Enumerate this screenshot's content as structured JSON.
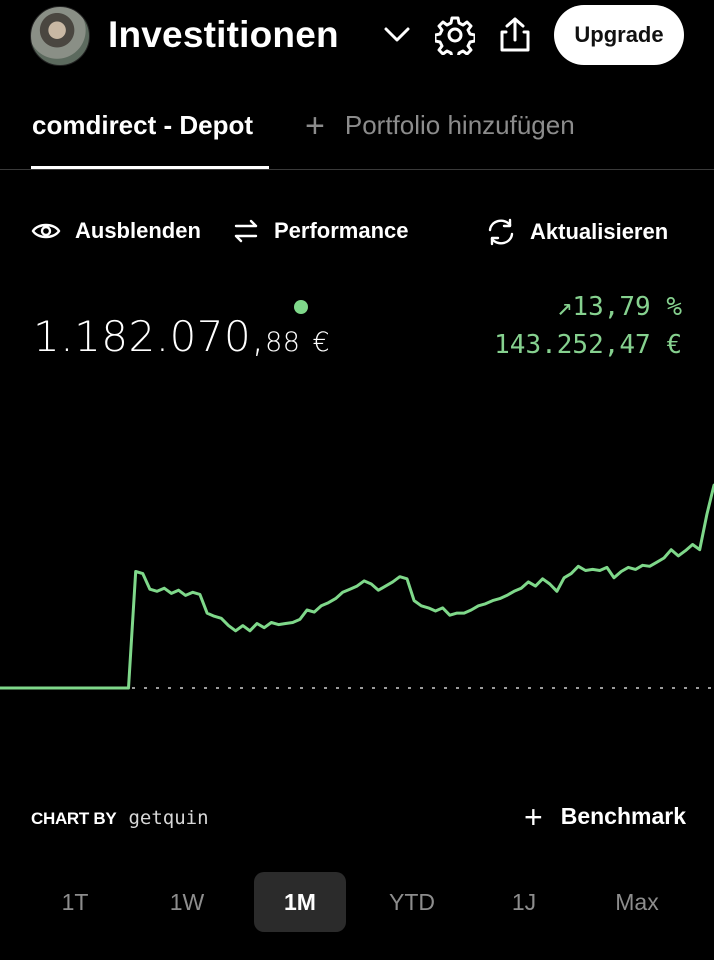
{
  "header": {
    "title": "Investitionen",
    "icons": [
      "avatar",
      "chevron-down-icon",
      "gear-icon",
      "share-icon"
    ],
    "upgrade_label": "Upgrade"
  },
  "tabs": {
    "active_label": "comdirect - Depot",
    "add_label": "Portfolio hinzufügen"
  },
  "actions": {
    "hide_label": "Ausblenden",
    "performance_label": "Performance",
    "refresh_label": "Aktualisieren"
  },
  "portfolio": {
    "value_main": "1.182.070,",
    "value_cents": "88",
    "currency": "€",
    "gain_percent": "↗13,79 %",
    "gain_amount": "143.252,47 €"
  },
  "colors": {
    "accent_green": "#7fd88a",
    "background": "#000000"
  },
  "chart_data": {
    "type": "line",
    "title": "",
    "xlabel": "",
    "ylabel": "",
    "baseline": 0,
    "x": [
      0,
      1,
      2,
      3,
      4,
      5,
      6,
      7,
      8,
      9,
      10,
      11,
      12,
      13,
      14,
      15,
      16,
      17,
      18,
      19,
      20,
      21,
      22,
      23,
      24,
      25,
      26,
      27,
      28,
      29,
      30,
      31,
      32,
      33,
      34,
      35,
      36,
      37,
      38,
      39,
      40,
      41,
      42,
      43,
      44,
      45,
      46,
      47,
      48,
      49,
      50,
      51,
      52,
      53,
      54,
      55,
      56,
      57,
      58,
      59,
      60,
      61,
      62,
      63,
      64,
      65,
      66,
      67,
      68,
      69,
      70,
      71,
      72,
      73,
      74,
      75,
      76,
      77,
      78,
      79,
      80,
      81,
      82,
      83,
      84,
      85,
      86,
      87,
      88,
      89,
      90,
      91,
      92,
      93,
      94,
      95,
      96,
      97,
      98,
      99,
      100
    ],
    "y": [
      0,
      0,
      0,
      0,
      0,
      0,
      0,
      0,
      0,
      0,
      0,
      0,
      0,
      0,
      0,
      0,
      0,
      0,
      0,
      112,
      110,
      95,
      93,
      96,
      91,
      94,
      89,
      92,
      90,
      72,
      69,
      67,
      60,
      55,
      60,
      55,
      62,
      58,
      63,
      61,
      62,
      63,
      66,
      75,
      73,
      79,
      82,
      86,
      92,
      95,
      98,
      103,
      100,
      94,
      98,
      102,
      107,
      105,
      84,
      79,
      77,
      74,
      77,
      70,
      72,
      72,
      75,
      79,
      81,
      84,
      86,
      89,
      93,
      96,
      102,
      98,
      105,
      100,
      93,
      106,
      110,
      117,
      113,
      114,
      113,
      116,
      106,
      112,
      116,
      114,
      118,
      117,
      121,
      125,
      133,
      127,
      132,
      138,
      133,
      167,
      195
    ],
    "ylim": [
      0,
      200
    ]
  },
  "footer": {
    "chart_by": "CHART BY",
    "brand": "getquin",
    "benchmark_label": "Benchmark"
  },
  "ranges": [
    "1T",
    "1W",
    "1M",
    "YTD",
    "1J",
    "Max"
  ],
  "active_range": "1M"
}
